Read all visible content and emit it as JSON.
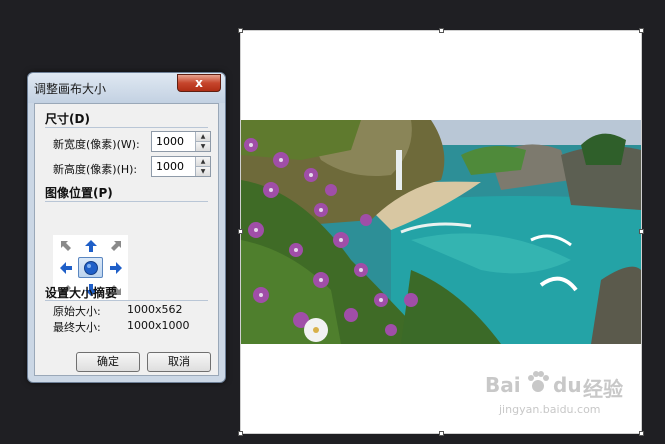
{
  "dialog": {
    "title": "调整画布大小",
    "close_label": "x",
    "size_section": "尺寸(D)",
    "width_label": "新宽度(像素)(W):",
    "width_value": "1000",
    "height_label": "新高度(像素)(H):",
    "height_value": "1000",
    "position_section": "图像位置(P)",
    "summary_section": "设置大小摘要",
    "original_label": "原始大小:",
    "original_value": "1000x562",
    "final_label": "最终大小:",
    "final_value": "1000x1000",
    "ok_label": "确定",
    "cancel_label": "取消"
  },
  "anchor_grid": [
    "arrow-up-left-icon",
    "arrow-up-icon",
    "arrow-up-right-icon",
    "arrow-left-icon",
    "anchor-center-icon",
    "arrow-right-icon",
    "arrow-down-left-icon",
    "arrow-down-icon",
    "arrow-down-right-icon"
  ],
  "colors": {
    "active_arrow": "#1f5fc8",
    "inactive_arrow": "#8a8a8a",
    "canvas": "#ffffff",
    "background": "#1f1f23"
  },
  "watermark": {
    "brand": "Bai",
    "brand2": "du",
    "suffix": "经验",
    "url": "jingyan.baidu.com"
  }
}
